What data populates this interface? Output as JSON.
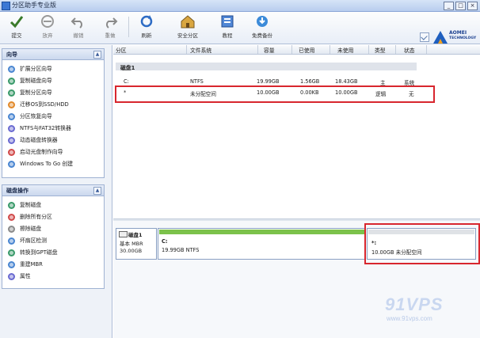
{
  "window": {
    "title": "分区助手专业版",
    "btn_min": "_",
    "btn_max": "□",
    "btn_close": "×"
  },
  "toolbar": {
    "submit": "提交",
    "discard": "放弃",
    "undo": "撤销",
    "redo": "重做",
    "refresh": "刷新",
    "safe_partition": "安全分区",
    "tutorial": "教程",
    "free_backup": "免费备份"
  },
  "logo": {
    "brand": "AOMEI",
    "tagline": "TECHNOLOGY"
  },
  "wizard": {
    "header": "向导",
    "items": [
      "扩展分区向导",
      "复制磁盘向导",
      "复制分区向导",
      "迁移OS到SSD/HDD",
      "分区恢复向导",
      "NTFS与FAT32转换器",
      "动态磁盘转换器",
      "启动光盘制作向导",
      "Windows To Go 创建"
    ]
  },
  "disk_ops": {
    "header": "磁盘操作",
    "items": [
      "复制磁盘",
      "删除所有分区",
      "擦除磁盘",
      "坏扇区检测",
      "转换到GPT磁盘",
      "重建MBR",
      "属性"
    ]
  },
  "table": {
    "columns": [
      "分区",
      "文件系统",
      "容量",
      "已使用",
      "未使用",
      "类型",
      "状态"
    ],
    "disk_label": "磁盘1",
    "rows": [
      {
        "part": "C:",
        "fs": "NTFS",
        "cap": "19.99GB",
        "used": "1.56GB",
        "free": "18.43GB",
        "type": "主",
        "status": "系统"
      },
      {
        "part": "*",
        "fs": "未分配空间",
        "cap": "10.00GB",
        "used": "0.00KB",
        "free": "10.00GB",
        "type": "逻辑",
        "status": "无"
      }
    ]
  },
  "diskmap": {
    "disk_name": "磁盘1",
    "disk_type": "基本 MBR",
    "disk_size": "30.00GB",
    "c_label": "C:",
    "c_detail": "19.99GB NTFS",
    "u_label": "*:",
    "u_detail": "10.00GB 未分配空间"
  },
  "watermark": {
    "big": "91VPS",
    "small": "www.91vps.com"
  },
  "colors": {
    "accent": "#3b78d4",
    "highlight": "#d8262e",
    "used_bar": "#7cc24b"
  }
}
